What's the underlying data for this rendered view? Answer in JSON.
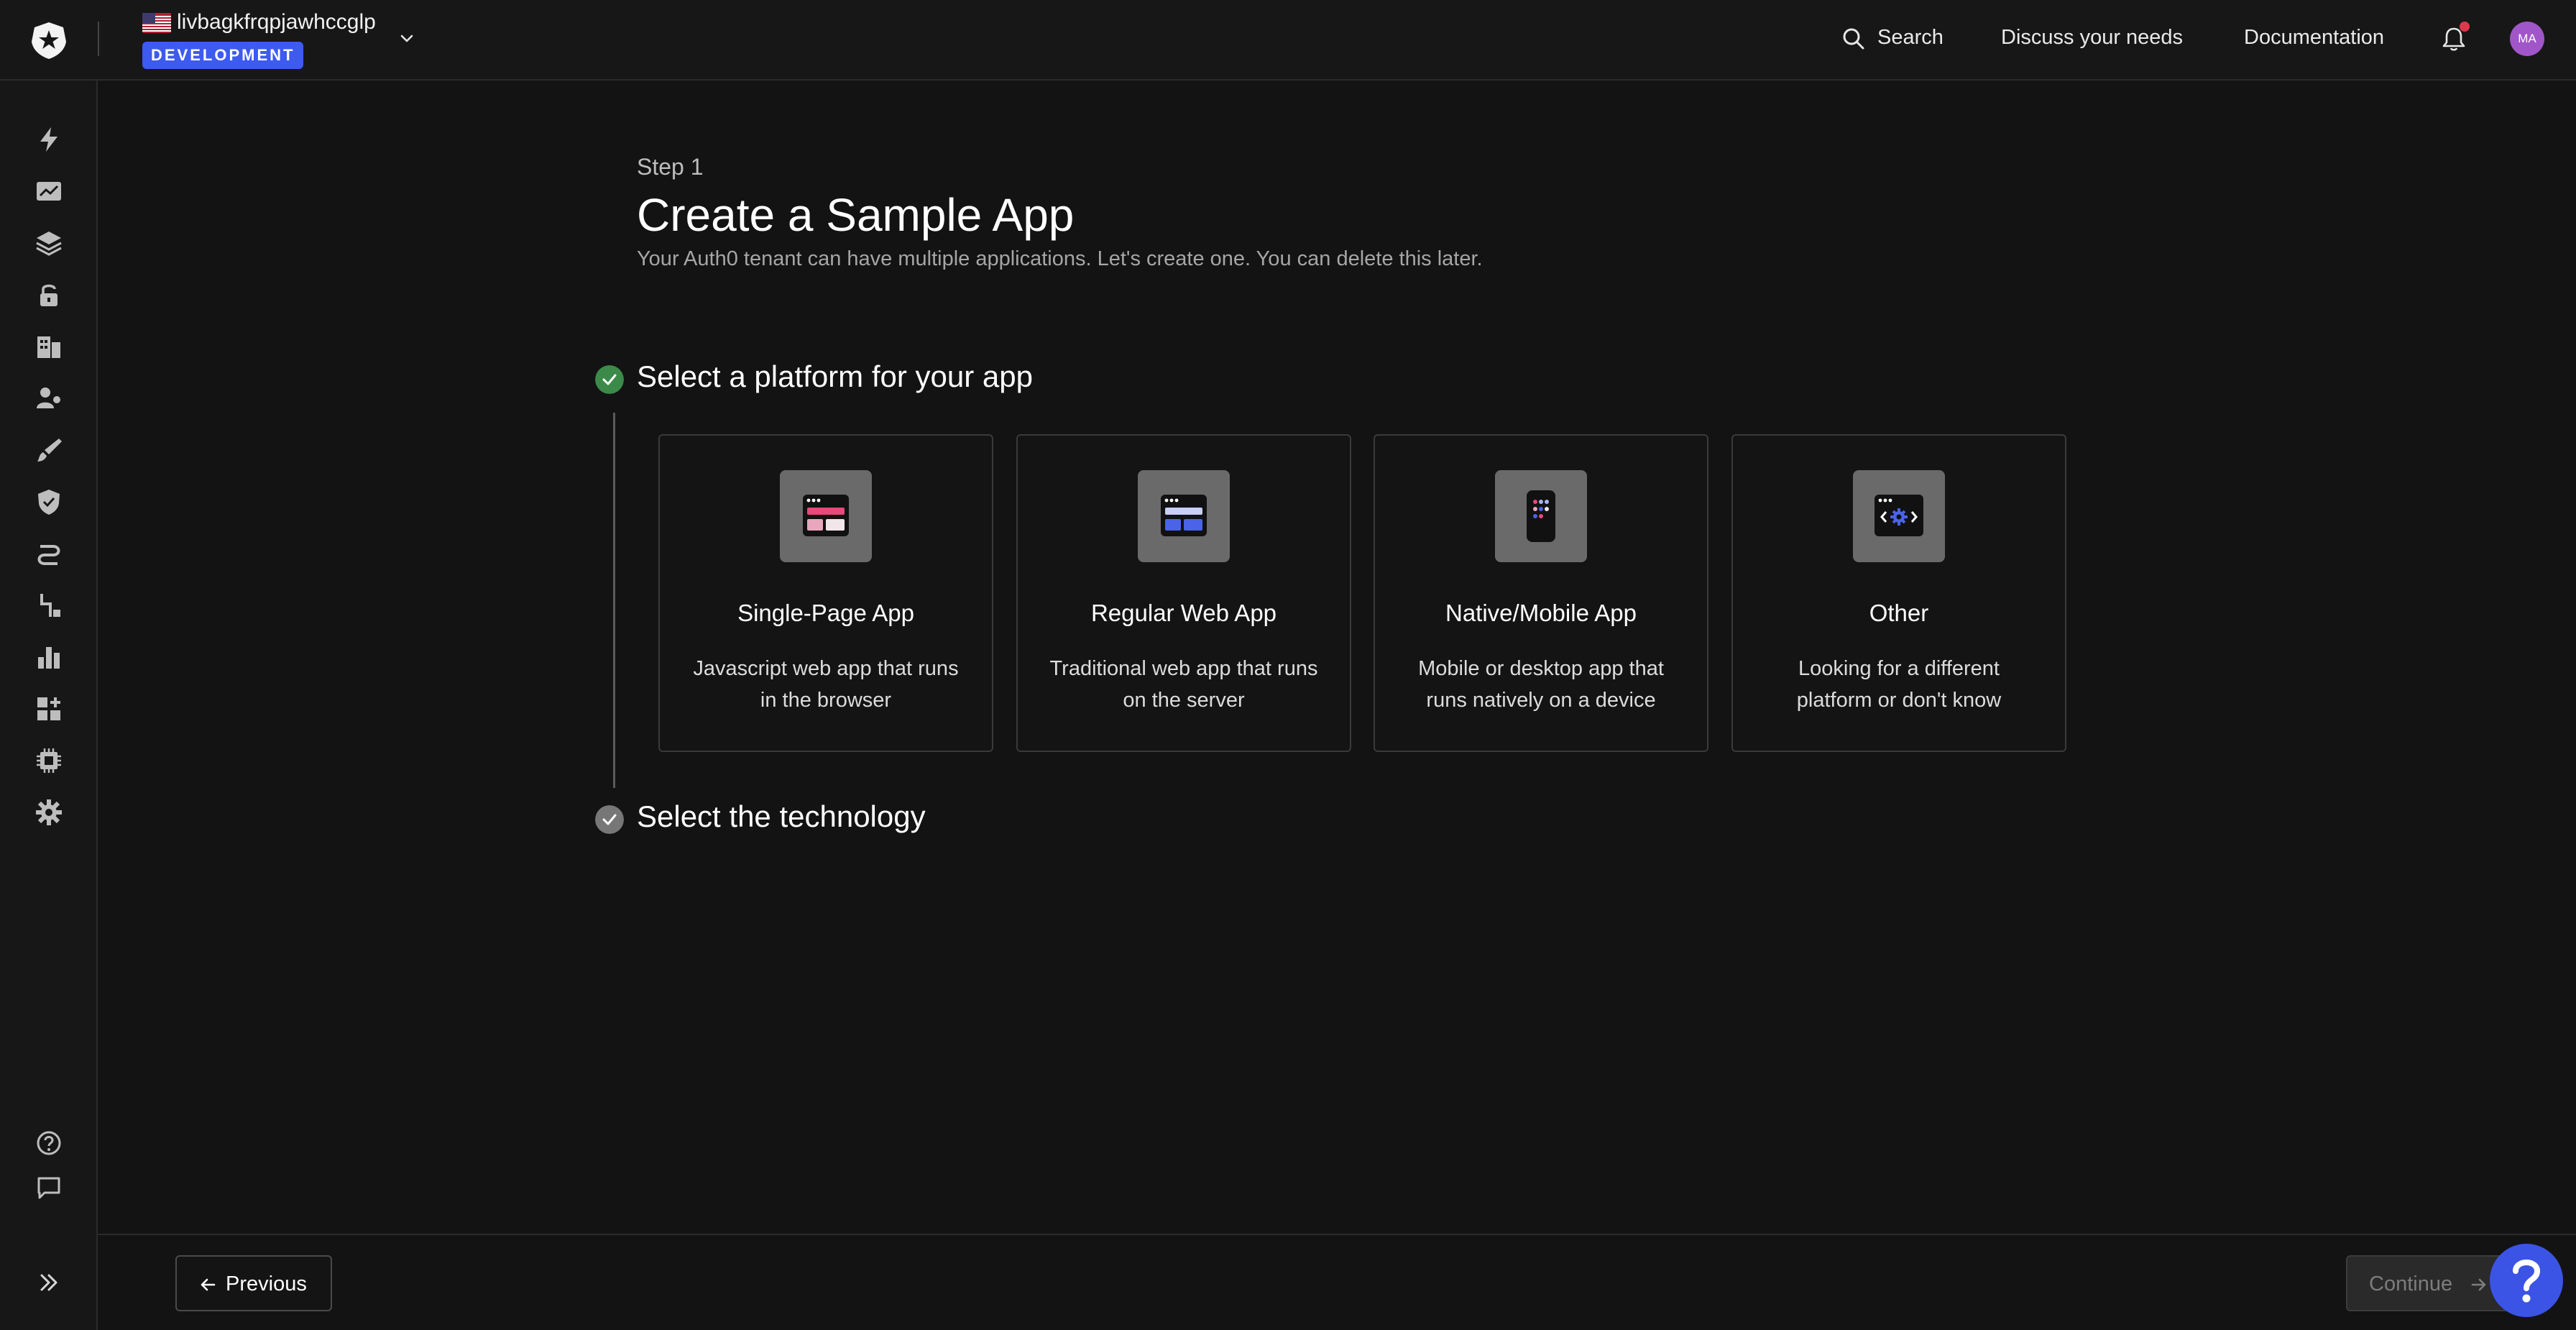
{
  "topbar": {
    "tenant_name": "livbagkfrqpjawhccglp",
    "env_badge": "DEVELOPMENT",
    "search_label": "Search",
    "discuss_label": "Discuss your needs",
    "docs_label": "Documentation",
    "avatar_initials": "MA",
    "notification_dot": true
  },
  "sidebar": {
    "icons": [
      "bolt-icon",
      "activity-icon",
      "layers-icon",
      "lock-icon",
      "organizations-icon",
      "users-icon",
      "brush-icon",
      "shield-icon",
      "pipeline-icon",
      "extensions-icon",
      "chart-icon",
      "marketplace-icon",
      "chip-icon",
      "gear-icon"
    ],
    "bottom_icons": [
      "help-icon",
      "feedback-icon"
    ]
  },
  "main": {
    "step_label": "Step 1",
    "title": "Create a Sample App",
    "subtitle": "Your Auth0 tenant can have multiple applications. Let's create one. You can delete this later.",
    "section_platform": "Select a platform for your app",
    "section_technology": "Select the technology",
    "cards": [
      {
        "title": "Single-Page App",
        "desc": "Javascript web app that runs in the browser"
      },
      {
        "title": "Regular Web App",
        "desc": "Traditional web app that runs on the server"
      },
      {
        "title": "Native/Mobile App",
        "desc": "Mobile or desktop app that runs natively on a device"
      },
      {
        "title": "Other",
        "desc": "Looking for a different platform or don't know"
      }
    ]
  },
  "footer": {
    "previous_label": "Previous",
    "continue_label": "Continue"
  },
  "colors": {
    "accent": "#3d5af1",
    "check_done": "#3c8a4a",
    "check_pending": "#777777",
    "notification": "#e0374c",
    "avatar": "#a056c9"
  }
}
